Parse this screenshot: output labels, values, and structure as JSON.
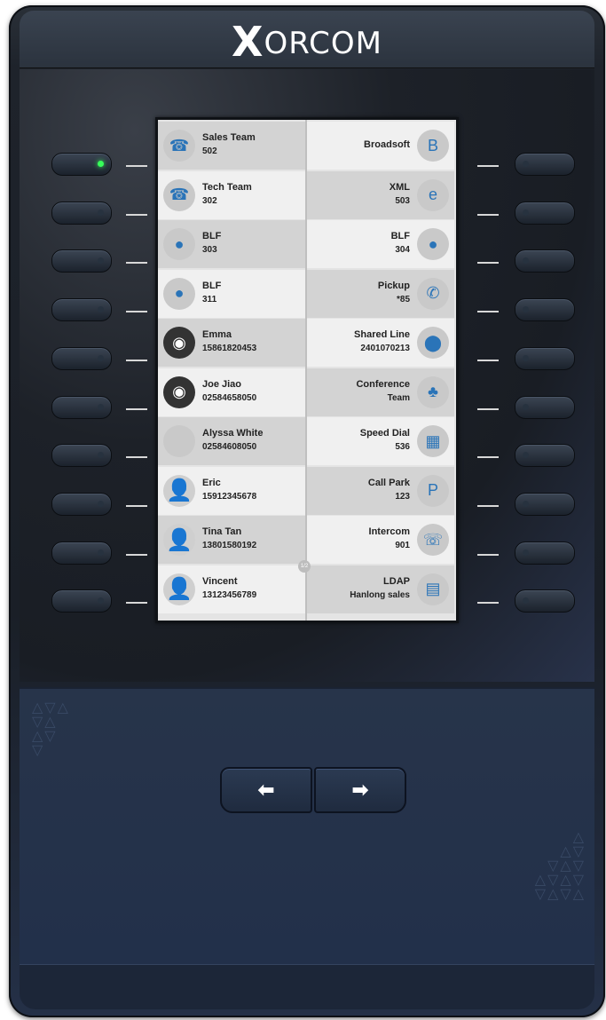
{
  "brand": {
    "x": "X",
    "rest": "ORCOM"
  },
  "screen": {
    "page_indicator": "1/2",
    "left": [
      {
        "name": "Sales Team",
        "detail": "502",
        "icon": "phone-icon",
        "glyph": "☎"
      },
      {
        "name": "Tech Team",
        "detail": "302",
        "icon": "phone-icon",
        "glyph": "☎"
      },
      {
        "name": "BLF",
        "detail": "303",
        "icon": "user-blue-icon",
        "glyph": "●"
      },
      {
        "name": "BLF",
        "detail": "311",
        "icon": "user-yellow-icon",
        "glyph": "●"
      },
      {
        "name": "Emma",
        "detail": "15861820453",
        "icon": "contact-photo-icon",
        "glyph": "◉"
      },
      {
        "name": "Joe Jiao",
        "detail": "02584658050",
        "icon": "contact-photo-icon",
        "glyph": "◉"
      },
      {
        "name": "Alyssa White",
        "detail": "02584608050",
        "icon": "empty-avatar-icon",
        "glyph": ""
      },
      {
        "name": "Eric",
        "detail": "15912345678",
        "icon": "person-silhouette-icon",
        "glyph": "👤"
      },
      {
        "name": "Tina Tan",
        "detail": "13801580192",
        "icon": "person-silhouette-icon",
        "glyph": "👤"
      },
      {
        "name": "Vincent",
        "detail": "13123456789",
        "icon": "person-silhouette-icon",
        "glyph": "👤"
      }
    ],
    "right": [
      {
        "name": "Broadsoft",
        "detail": "",
        "icon": "broadsoft-icon",
        "glyph": "B"
      },
      {
        "name": "XML",
        "detail": "503",
        "icon": "xml-browser-icon",
        "glyph": "e"
      },
      {
        "name": "BLF",
        "detail": "304",
        "icon": "user-blue-icon",
        "glyph": "●"
      },
      {
        "name": "Pickup",
        "detail": "*85",
        "icon": "pickup-icon",
        "glyph": "✆"
      },
      {
        "name": "Shared Line",
        "detail": "2401070213",
        "icon": "shared-line-icon",
        "glyph": "⬤"
      },
      {
        "name": "Conference",
        "detail": "Team",
        "icon": "conference-icon",
        "glyph": "♣"
      },
      {
        "name": "Speed Dial",
        "detail": "536",
        "icon": "speed-dial-icon",
        "glyph": "▦"
      },
      {
        "name": "Call Park",
        "detail": "123",
        "icon": "call-park-icon",
        "glyph": "P"
      },
      {
        "name": "Intercom",
        "detail": "901",
        "icon": "intercom-icon",
        "glyph": "☏"
      },
      {
        "name": "LDAP",
        "detail": "Hanlong sales",
        "icon": "ldap-icon",
        "glyph": "▤"
      }
    ]
  },
  "leds": {
    "left_first_on": true,
    "color_on": "#37ff5a"
  },
  "nav": {
    "back_glyph": "⬅",
    "forward_glyph": "➡"
  }
}
